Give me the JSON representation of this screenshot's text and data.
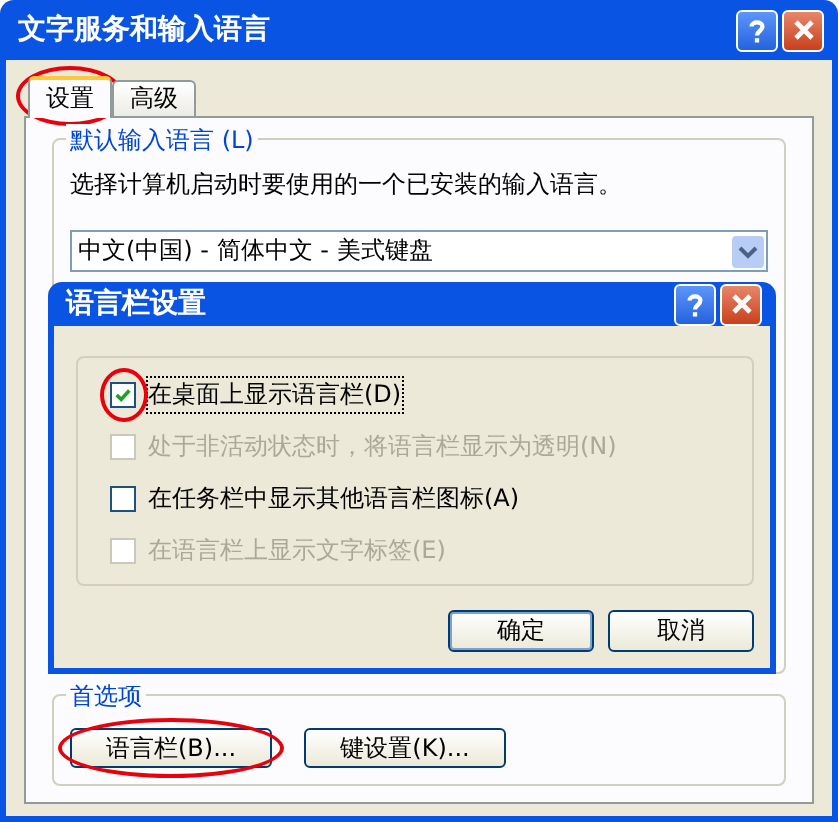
{
  "window": {
    "title": "文字服务和输入语言"
  },
  "tabs": [
    {
      "label": "设置",
      "selected": true,
      "circled": true
    },
    {
      "label": "高级",
      "selected": false,
      "circled": false
    }
  ],
  "default_language": {
    "title": "默认输入语言 (L)",
    "description": "选择计算机启动时要使用的一个已安装的输入语言。",
    "value": "中文(中国) - 简体中文 - 美式键盘"
  },
  "preferences": {
    "title": "首选项",
    "buttons": [
      {
        "label": "语言栏(B)...",
        "circled": true
      },
      {
        "label": "键设置(K)...",
        "circled": false
      }
    ]
  },
  "dialog": {
    "title": "语言栏设置",
    "options": [
      {
        "label": "在桌面上显示语言栏(D)",
        "checked": true,
        "disabled": false,
        "circled": true
      },
      {
        "label": "处于非活动状态时，将语言栏显示为透明(N)",
        "checked": false,
        "disabled": true,
        "circled": false
      },
      {
        "label": "在任务栏中显示其他语言栏图标(A)",
        "checked": false,
        "disabled": false,
        "circled": false
      },
      {
        "label": "在语言栏上显示文字标签(E)",
        "checked": false,
        "disabled": true,
        "circled": false
      }
    ],
    "buttons": [
      "确定",
      "取消"
    ]
  }
}
